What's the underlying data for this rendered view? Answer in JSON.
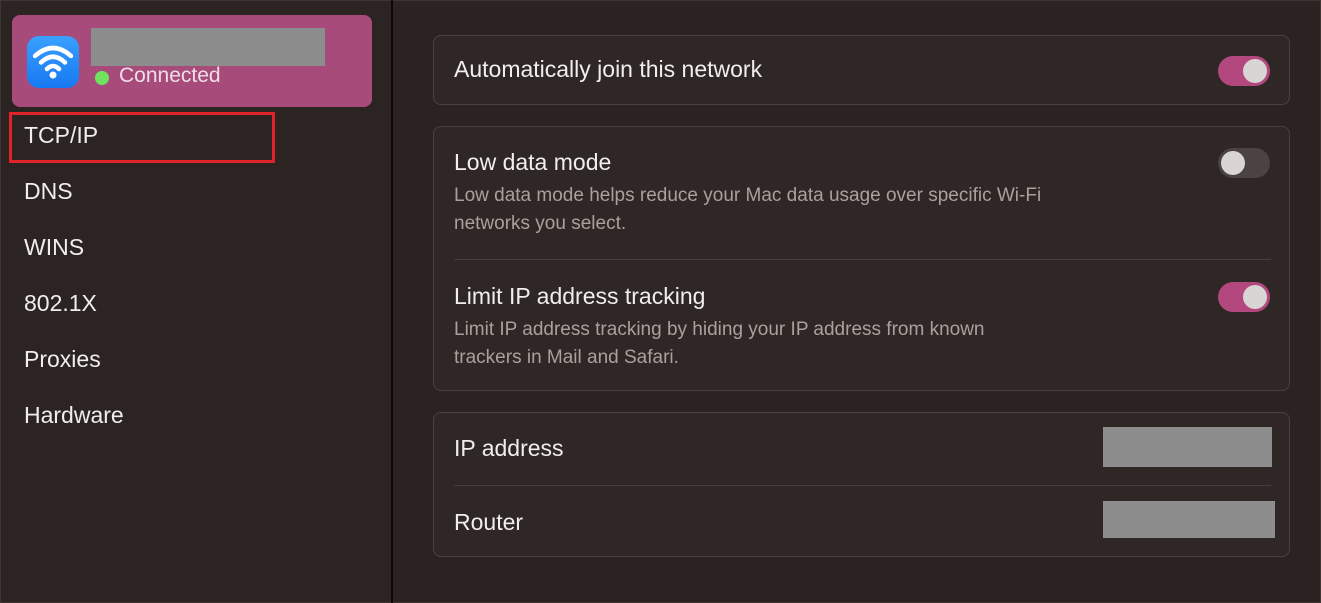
{
  "sidebar": {
    "network": {
      "name": "",
      "status": "Connected",
      "icon": "wifi-icon",
      "status_color": "#6fe25f"
    },
    "items": [
      {
        "label": "TCP/IP",
        "selected": true
      },
      {
        "label": "DNS"
      },
      {
        "label": "WINS"
      },
      {
        "label": "802.1X"
      },
      {
        "label": "Proxies"
      },
      {
        "label": "Hardware"
      }
    ]
  },
  "main": {
    "auto_join": {
      "label": "Automatically join this network",
      "enabled": true
    },
    "low_data": {
      "label": "Low data mode",
      "description_line1": "Low data mode helps reduce your Mac data usage over specific Wi-Fi",
      "description_line2": "networks you select.",
      "enabled": false
    },
    "limit_ip": {
      "label": "Limit IP address tracking",
      "description_line1": "Limit IP address tracking by hiding your IP address from known",
      "description_line2": "trackers in Mail and Safari.",
      "enabled": true
    },
    "info": [
      {
        "label": "IP address",
        "value": ""
      },
      {
        "label": "Router",
        "value": ""
      }
    ]
  },
  "colors": {
    "accent": "#b2487d",
    "selected_network_bg": "#a64b7a",
    "highlight_box": "#e2222a"
  }
}
